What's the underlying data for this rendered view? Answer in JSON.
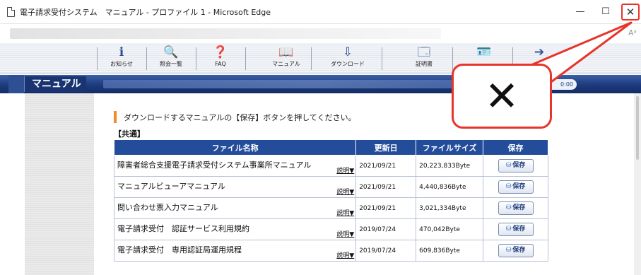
{
  "window": {
    "title": "電子請求受付システム　マニュアル - プロファイル 1 - Microsoft Edge",
    "minimize": "—",
    "maximize": "☐",
    "close": "✕"
  },
  "address_bar": {
    "aa": "Aᵃ"
  },
  "toolbar": {
    "items": [
      {
        "label": "お知らせ",
        "icon": "info-icon",
        "glyph": "ℹ"
      },
      {
        "label": "照会一覧",
        "icon": "search-icon",
        "glyph": "🔍"
      },
      {
        "label": "FAQ",
        "icon": "faq-icon",
        "glyph": "❓"
      },
      {
        "label": "マニュアル",
        "icon": "manual-book-icon",
        "glyph": "📖"
      },
      {
        "label": "ダウンロード",
        "icon": "download-icon",
        "glyph": "⇩"
      },
      {
        "label": "証明書",
        "icon": "certificate-icon",
        "glyph": "🗔"
      },
      {
        "label": "",
        "icon": "user-card-icon",
        "glyph": "🪪"
      },
      {
        "label": "",
        "icon": "logout-icon",
        "glyph": "➔"
      }
    ]
  },
  "band": {
    "title": "マニュアル",
    "pill": "0:00"
  },
  "content": {
    "instruction": "ダウンロードするマニュアルの【保存】ボタンを押してください。",
    "section": "【共通】",
    "table": {
      "headers": [
        "ファイル名称",
        "更新日",
        "ファイルサイズ",
        "保存"
      ],
      "rows": [
        {
          "name": "障害者総合支援電子請求受付システム事業所マニュアル",
          "explain": "説明▼",
          "date": "2021/09/21",
          "size": "20,223,833Byte",
          "save": "保存"
        },
        {
          "name": "マニュアルビューアマニュアル",
          "explain": "説明▼",
          "date": "2021/09/21",
          "size": "4,440,836Byte",
          "save": "保存"
        },
        {
          "name": "問い合わせ票入力マニュアル",
          "explain": "説明▼",
          "date": "2021/09/21",
          "size": "3,021,334Byte",
          "save": "保存"
        },
        {
          "name": "電子請求受付　認証サービス利用規約",
          "explain": "説明▼",
          "date": "2019/07/24",
          "size": "470,042Byte",
          "save": "保存"
        },
        {
          "name": "電子請求受付　専用認証局運用規程",
          "explain": "説明▼",
          "date": "2019/07/24",
          "size": "609,836Byte",
          "save": "保存"
        }
      ]
    }
  },
  "callout": {
    "symbol": "✕",
    "color": "#e8342b"
  }
}
